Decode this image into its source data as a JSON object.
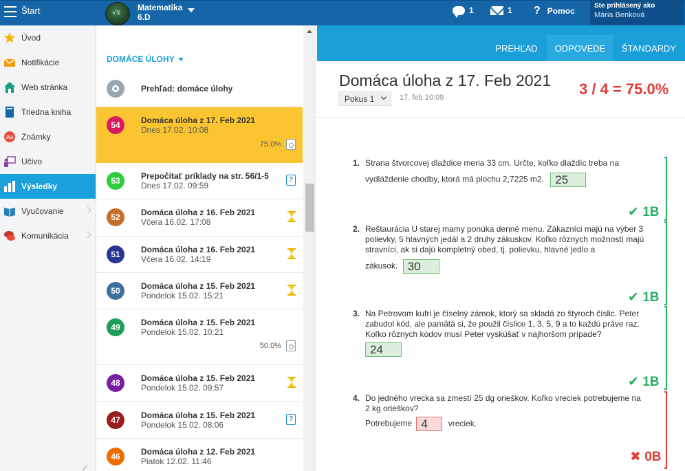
{
  "topbar": {
    "start_label": "Štart",
    "class_name": "Matematika",
    "class_sub": "6.D",
    "messages_count": "1",
    "mail_count": "1",
    "help_label": "Pomoc",
    "login_label": "Ste prihlásený ako",
    "user_name": "Mária Benková"
  },
  "sidebar": {
    "items": [
      {
        "label": "Úvod",
        "icon": "star-icon"
      },
      {
        "label": "Notifikácie",
        "icon": "envelope-icon"
      },
      {
        "label": "Web stránka",
        "icon": "house-icon"
      },
      {
        "label": "Triedna kniha",
        "icon": "book-icon"
      },
      {
        "label": "Známky",
        "icon": "grades-icon"
      },
      {
        "label": "Učivo",
        "icon": "teacher-icon"
      },
      {
        "label": "Výsledky",
        "icon": "bar-chart-icon"
      },
      {
        "label": "Vyučovanie",
        "icon": "open-book-icon"
      },
      {
        "label": "Komunikácia",
        "icon": "chat-icon"
      }
    ]
  },
  "homework": {
    "title": "DOMÁCE ÚLOHY",
    "overview": "Prehľad: domáce úlohy",
    "items": [
      {
        "num": "54",
        "title": "Domáca úloha z 17. Feb 2021",
        "date": "Dnes 17.02. 10:08",
        "pct": "75.0%",
        "color": "#d81b60",
        "status": "graded"
      },
      {
        "num": "53",
        "title": "Prepočítať príklady na str. 56/1-5",
        "date": "Dnes 17.02. 09:59",
        "pct": "",
        "color": "#2ecc40",
        "status": "question"
      },
      {
        "num": "52",
        "title": "Domáca úloha z 16. Feb 2021",
        "date": "Včera 16.02. 17:08",
        "pct": "",
        "color": "#c4702a",
        "status": "pending"
      },
      {
        "num": "51",
        "title": "Domáca úloha z 16. Feb 2021",
        "date": "Včera 16.02. 14:19",
        "pct": "",
        "color": "#283593",
        "status": "pending"
      },
      {
        "num": "50",
        "title": "Domáca úloha z 15. Feb 2021",
        "date": "Pondelok 15.02. 15:21",
        "pct": "",
        "color": "#3f6f9f",
        "status": "pending"
      },
      {
        "num": "49",
        "title": "Domáca úloha z 15. Feb 2021",
        "date": "Pondelok 15.02. 10:21",
        "pct": "50.0%",
        "color": "#1e9e5a",
        "status": "graded"
      },
      {
        "num": "48",
        "title": "Domáca úloha z 15. Feb 2021",
        "date": "Pondelok 15.02. 09:57",
        "pct": "",
        "color": "#7b1fa2",
        "status": "pending"
      },
      {
        "num": "47",
        "title": "Domáca úloha z 15. Feb 2021",
        "date": "Pondelok 15.02. 08:06",
        "pct": "",
        "color": "#9b1c1c",
        "status": "question"
      },
      {
        "num": "46",
        "title": "Domáca úloha z 12. Feb 2021",
        "date": "Piatok 12.02. 11:46",
        "pct": "",
        "color": "#ef6c00",
        "status": "none"
      }
    ]
  },
  "right": {
    "tabs": [
      "PREHĽAD",
      "ODPOVEDE",
      "ŠTANDARDY"
    ],
    "heading": "Domáca úloha z 17. Feb 2021",
    "score": "3 / 4 = 75.0%",
    "attempt": "Pokus 1",
    "attempt_date": "17. feb 10:09",
    "questions": [
      {
        "n": "1.",
        "text": "Strana štvorcovej dlaždice meria 33 cm. Určte, koľko dlaždíc treba na",
        "text2": "vydláždenie chodby, ktorá má plochu 2,7225 m2.",
        "answer": "25",
        "points": "✔ 1B",
        "correct": true
      },
      {
        "n": "2.",
        "text": "Reštaurácia U starej mamy ponúka denné menu. Zákazníci majú na výber 3 polievky, 5 hlavných jedál a 2 druhy zákuskov. Koľko rôznych možností majú stravníci, ak si dajú kompletný obed, tj. polievku, hlavné jedlo a",
        "text2": "zákusok.",
        "answer": "30",
        "points": "✔ 1B",
        "correct": true
      },
      {
        "n": "3.",
        "text": "Na Petrovom kufri je číselný zámok, ktorý sa skladá zo štyroch číslic. Peter zabudol kód, ale pamätá si, že použil číslice 1, 3, 5, 9 a to každú práve raz. Koľko rôznych kódov musí Peter vyskúšať v najhoršom prípade?",
        "text2": "",
        "answer": "24",
        "points": "✔ 1B",
        "correct": true
      },
      {
        "n": "4.",
        "text": "Do jedného vrecka sa zmestí 25 dg orieškov. Koľko vreciek potrebujeme na 2 kg orieškov?",
        "text2": "Potrebujeme",
        "answer": "4",
        "suffix": "vreciek.",
        "points": "✖ 0B",
        "correct": false
      }
    ]
  }
}
